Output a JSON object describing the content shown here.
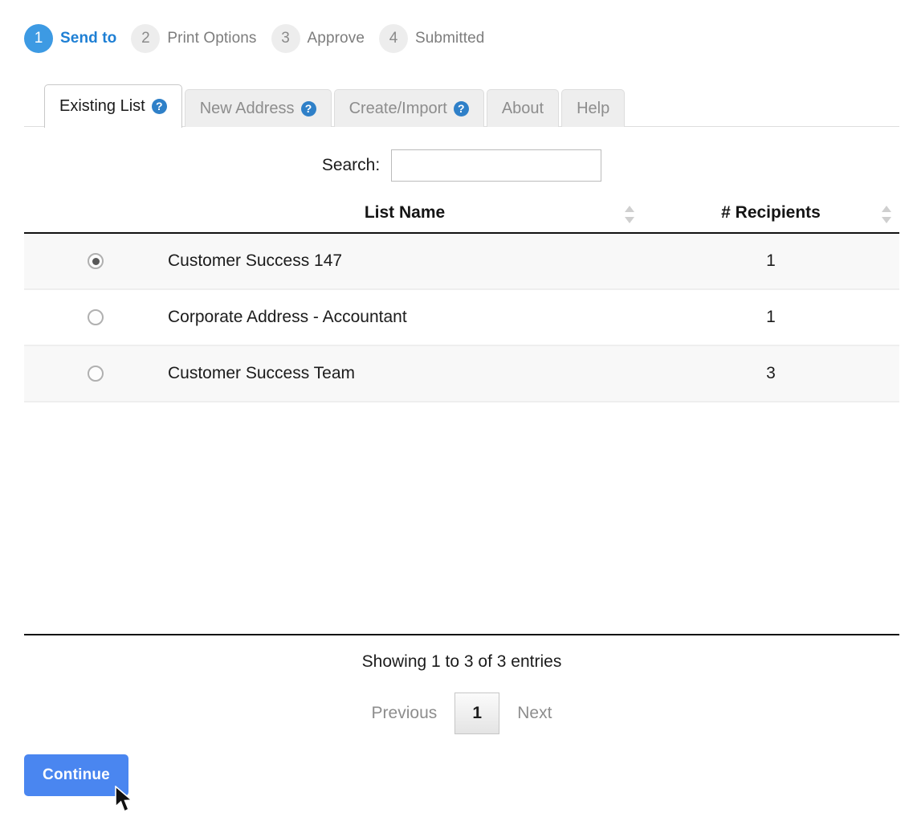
{
  "wizard": {
    "steps": [
      {
        "number": "1",
        "label": "Send to",
        "active": true
      },
      {
        "number": "2",
        "label": "Print Options",
        "active": false
      },
      {
        "number": "3",
        "label": "Approve",
        "active": false
      },
      {
        "number": "4",
        "label": "Submitted",
        "active": false
      }
    ],
    "active_color": "#3d9ae3",
    "active_label_color": "#1e7fd4",
    "inactive_circle_color": "#ededed"
  },
  "tabs": [
    {
      "label": "Existing List",
      "help": "?",
      "active": true
    },
    {
      "label": "New Address",
      "help": "?",
      "active": false
    },
    {
      "label": "Create/Import",
      "help": "?",
      "active": false
    },
    {
      "label": "About",
      "help": "",
      "active": false
    },
    {
      "label": "Help",
      "help": "",
      "active": false
    }
  ],
  "search": {
    "label": "Search:",
    "value": "",
    "placeholder": ""
  },
  "table": {
    "columns": [
      {
        "key": "select",
        "label": ""
      },
      {
        "key": "name",
        "label": "List Name",
        "sortable": true
      },
      {
        "key": "recipients",
        "label": "# Recipients",
        "sortable": true
      }
    ],
    "rows": [
      {
        "selected": true,
        "name": "Customer Success 147",
        "recipients": "1"
      },
      {
        "selected": false,
        "name": "Corporate Address - Accountant",
        "recipients": "1"
      },
      {
        "selected": false,
        "name": "Customer Success Team",
        "recipients": "3"
      }
    ]
  },
  "footer": {
    "showing": "Showing 1 to 3 of 3 entries",
    "previous_label": "Previous",
    "next_label": "Next",
    "current_page": "1"
  },
  "actions": {
    "continue_label": "Continue",
    "continue_color": "#4a86f0"
  },
  "icons": {
    "help": "help-circle-icon",
    "sort": "sort-arrows-icon",
    "cursor": "mouse-pointer-icon"
  }
}
